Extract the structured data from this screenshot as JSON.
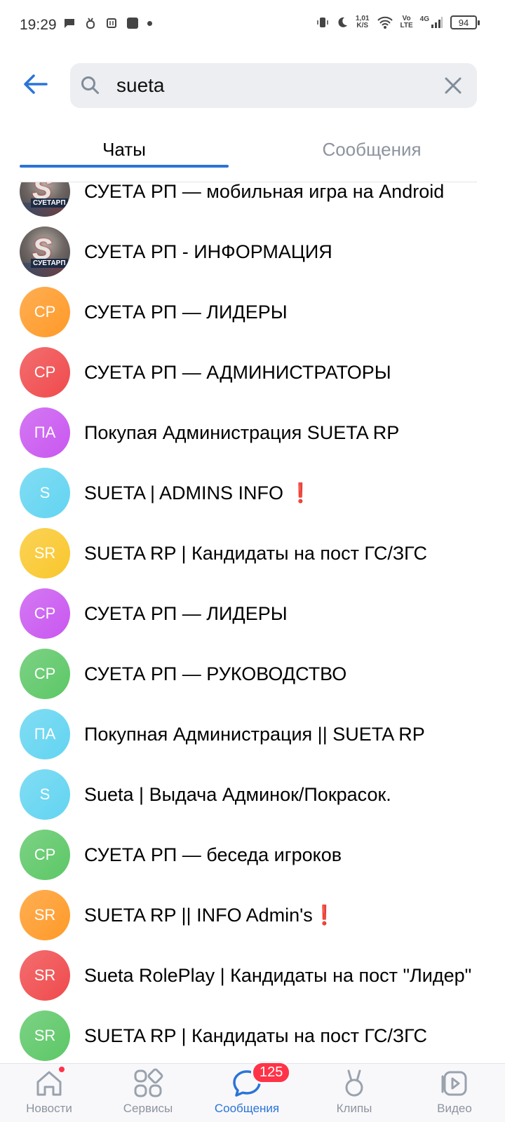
{
  "status_bar": {
    "time": "19:29",
    "speed_value": "1,01",
    "speed_unit": "K/S",
    "volte_top": "Vo",
    "volte_bottom": "LTE",
    "network": "4G",
    "battery": "94"
  },
  "search": {
    "query": "sueta"
  },
  "tabs": {
    "chats": "Чаты",
    "messages": "Сообщения"
  },
  "chats": [
    {
      "title": "СУЕТА РП — мобильная игра на Android",
      "avatar": "photo",
      "tag": "СУЕТАРП"
    },
    {
      "title": "СУЕТА РП - ИНФОРМАЦИЯ",
      "avatar": "photo",
      "tag": "СУЕТАРП"
    },
    {
      "title": "СУЕТА РП — ЛИДЕРЫ",
      "initials": "СР",
      "color": "#ff9a28"
    },
    {
      "title": "СУЕТА РП — АДМИНИСТРАТОРЫ",
      "initials": "СР",
      "color": "#f04a4c"
    },
    {
      "title": "Покупая Администрация SUETA RP",
      "initials": "ПА",
      "color": "#c957f0"
    },
    {
      "title": "SUETA | ADMINS INFO ",
      "suffix": "❗",
      "initials": "S",
      "color": "#62d4f1"
    },
    {
      "title": "SUETA RP | Кандидаты на пост ГС/ЗГС",
      "initials": "SR",
      "color": "#f9c72c"
    },
    {
      "title": "СУЕТА РП — ЛИДЕРЫ",
      "initials": "СР",
      "color": "#c957f0"
    },
    {
      "title": "СУЕТА РП — РУКОВОДСТВО",
      "initials": "СР",
      "color": "#5cc766"
    },
    {
      "title": "Покупная Администрация || SUETA RP",
      "initials": "ПА",
      "color": "#62d4f1"
    },
    {
      "title": "Sueta | Выдача Админок/Покрасок.",
      "initials": "S",
      "color": "#62d4f1"
    },
    {
      "title": "СУЕТА РП — беседа игроков",
      "initials": "СР",
      "color": "#5cc766"
    },
    {
      "title": "SUETA RP ||  INFO Admin's",
      "suffix": "❗",
      "initials": "SR",
      "color": "#ff9a28"
    },
    {
      "title": "Sueta RolePlay | Кандидаты на пост \"Лидер\"",
      "initials": "SR",
      "color": "#f04a4c"
    },
    {
      "title": "SUETA RP | Кандидаты на пост ГС/ЗГС",
      "initials": "SR",
      "color": "#5cc766"
    }
  ],
  "bottom_nav": {
    "news": "Новости",
    "services": "Сервисы",
    "messages": "Сообщения",
    "messages_badge": "125",
    "clips": "Клипы",
    "video": "Видео"
  },
  "colors": {
    "accent": "#2a74d8",
    "badge": "#ff3347"
  }
}
